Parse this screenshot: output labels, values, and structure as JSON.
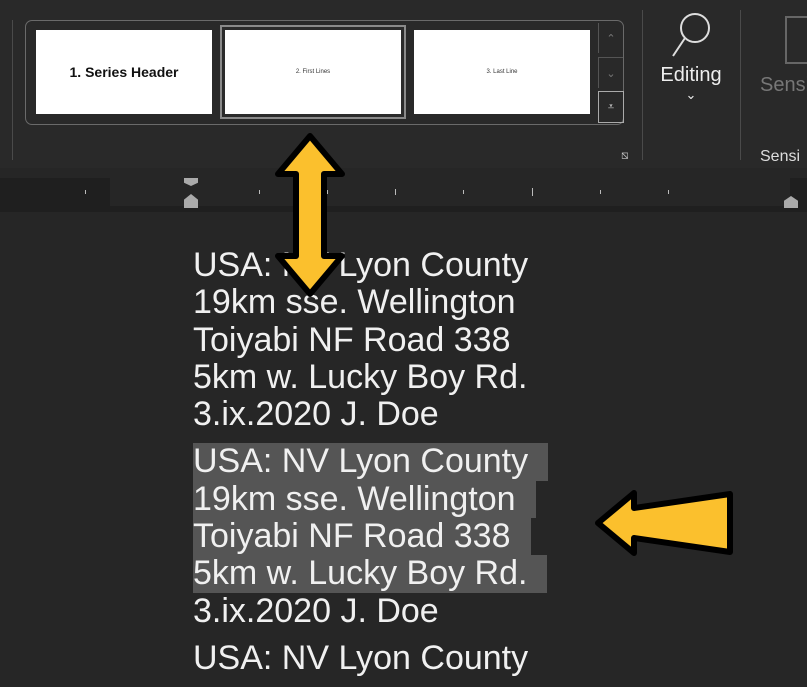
{
  "styles_gallery": {
    "items": [
      {
        "label": "1. Series Header"
      },
      {
        "label": "2. First Lines"
      },
      {
        "label": "3. Last Line"
      }
    ],
    "selected_index": 1
  },
  "editing": {
    "label": "Editing"
  },
  "sensitivity": {
    "label": "Sensi",
    "group_label": "Sensi"
  },
  "document": {
    "blocks": [
      {
        "lines": [
          "USA: NV Lyon County",
          "19km sse. Wellington",
          "Toiyabi NF Road 338",
          "5km w. Lucky Boy Rd.",
          "3.ix.2020 J. Doe"
        ],
        "highlighted": false
      },
      {
        "lines": [
          "USA: NV Lyon County",
          "19km sse. Wellington",
          "Toiyabi NF Road 338",
          "5km w. Lucky Boy Rd.",
          "3.ix.2020 J. Doe"
        ],
        "highlighted": true
      },
      {
        "lines": [
          "USA: NV Lyon County"
        ],
        "highlighted": false
      }
    ]
  },
  "colors": {
    "arrow": "#FBC02D",
    "highlight": "#555555"
  }
}
